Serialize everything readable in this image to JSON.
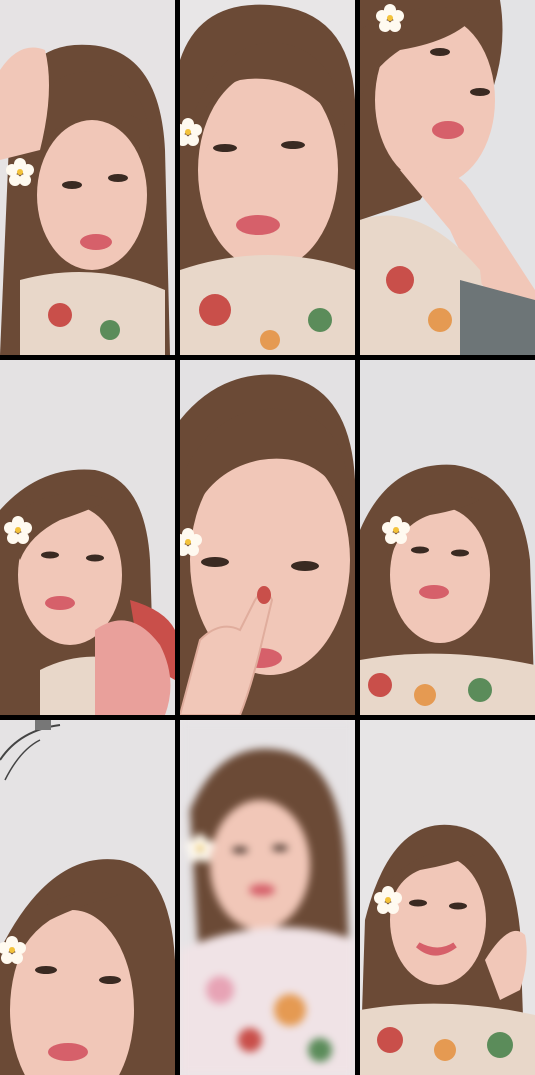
{
  "collage": {
    "layout": "3x3 grid",
    "background_color": "#000000",
    "wall_color": "#e9e7e8",
    "hair_color": "#6b4a36",
    "skin_color": "#f1c7b8",
    "lip_color": "#d6606a",
    "flower_color": "#fffaf0",
    "flower_center_color": "#f3c23a",
    "shirt_pattern_colors": [
      "#c94f4a",
      "#e59a52",
      "#5b8c5a",
      "#e8d7c9"
    ],
    "frames": [
      {
        "id": "frame-1",
        "icon": "portrait-hand-on-head"
      },
      {
        "id": "frame-2",
        "icon": "portrait-closeup"
      },
      {
        "id": "frame-3",
        "icon": "portrait-chin-on-hand"
      },
      {
        "id": "frame-4",
        "icon": "portrait-hand-foreground"
      },
      {
        "id": "frame-5",
        "icon": "portrait-finger-on-nose"
      },
      {
        "id": "frame-6",
        "icon": "portrait-smiling"
      },
      {
        "id": "frame-7",
        "icon": "portrait-low-angle"
      },
      {
        "id": "frame-8",
        "icon": "portrait-motion-blur"
      },
      {
        "id": "frame-9",
        "icon": "portrait-smiling-hand-raised"
      }
    ]
  }
}
